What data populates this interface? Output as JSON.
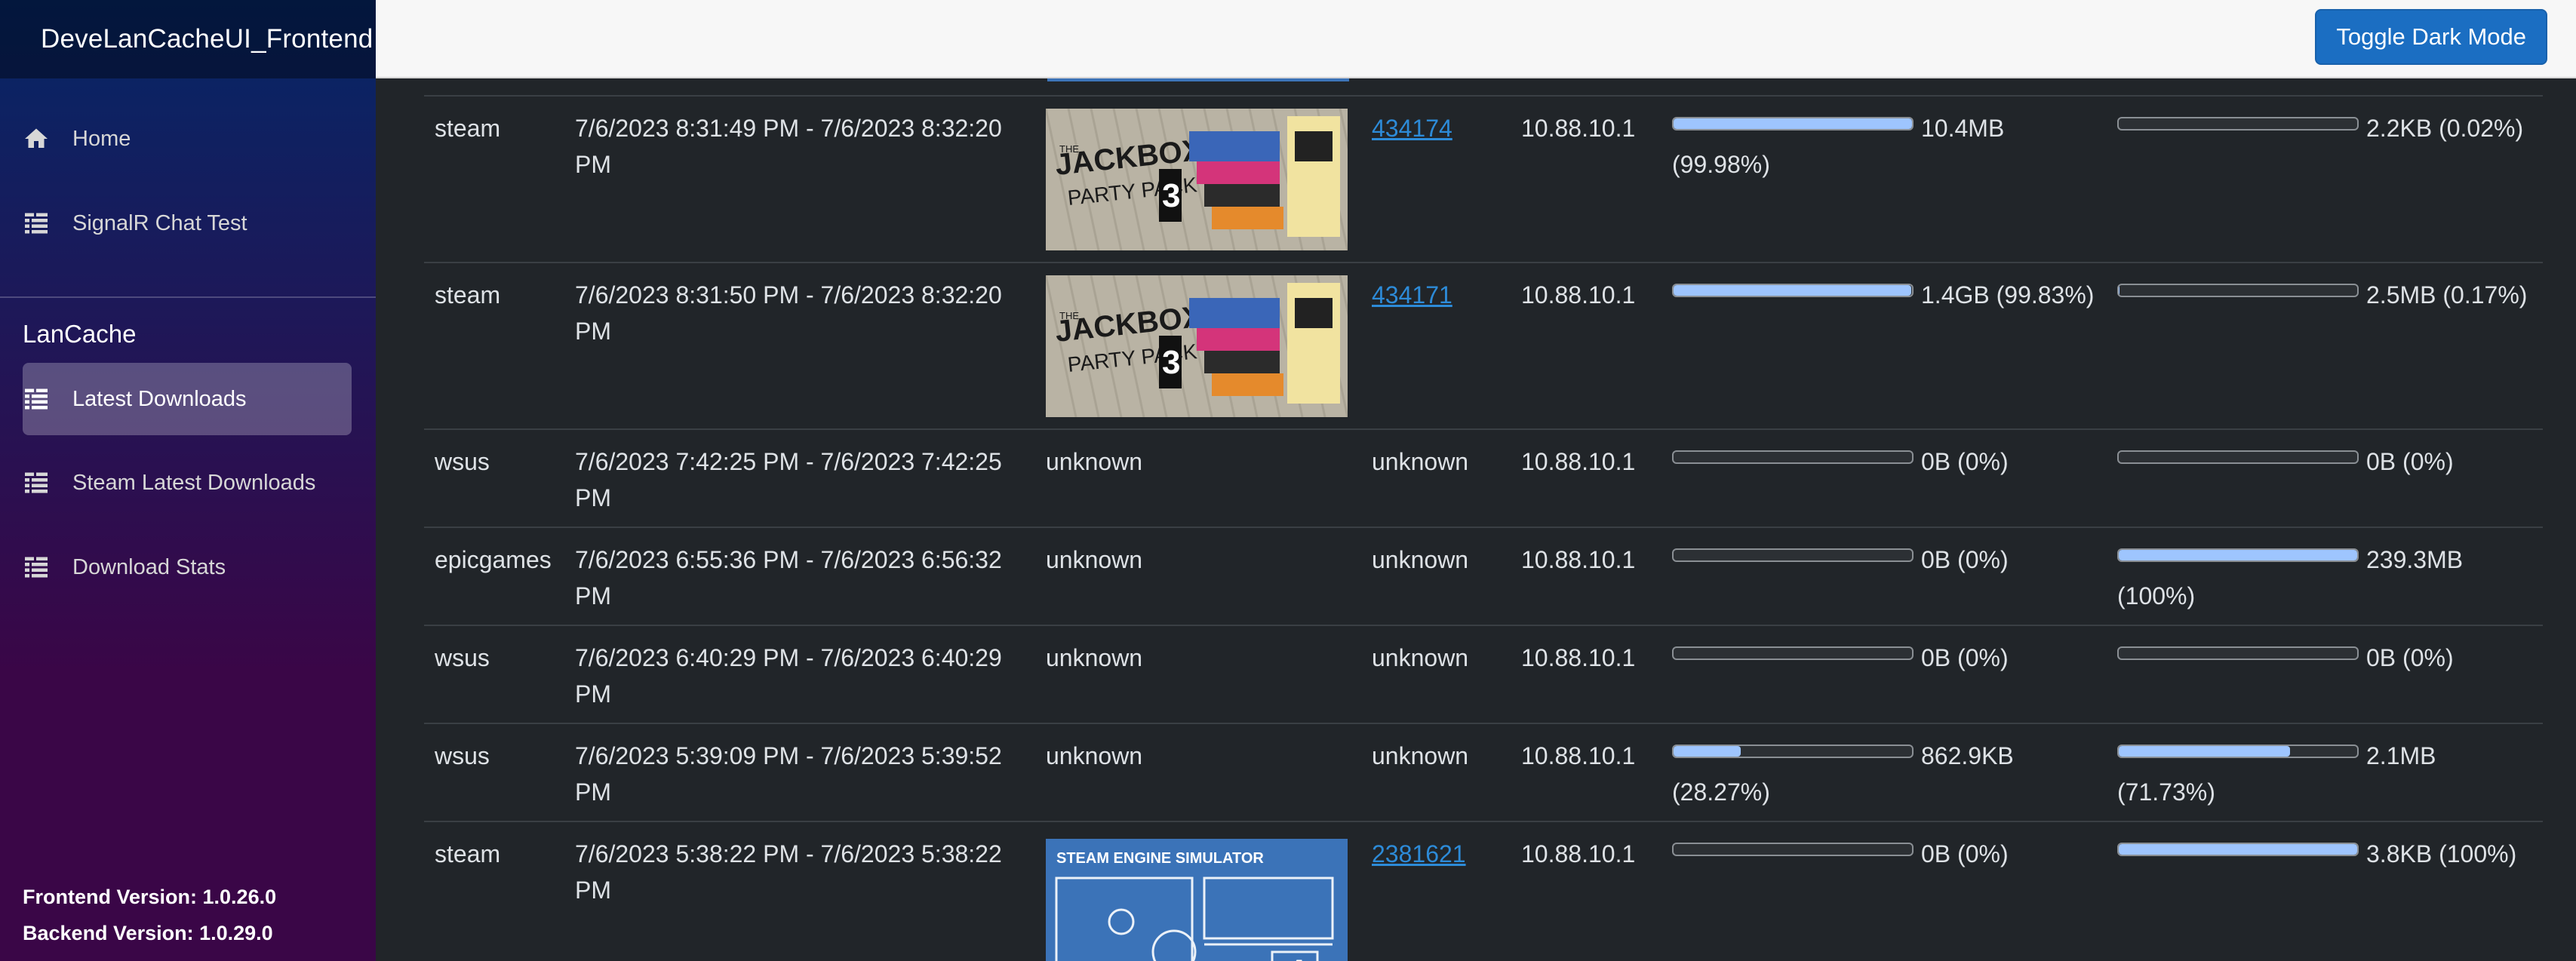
{
  "app": {
    "title": "DeveLanCacheUI_Frontend"
  },
  "sidebar": {
    "items": [
      {
        "label": "Home",
        "icon": "home-icon"
      },
      {
        "label": "SignalR Chat Test",
        "icon": "list-icon"
      }
    ],
    "section_heading": "LanCache",
    "lancache_items": [
      {
        "label": "Latest Downloads",
        "icon": "list-icon",
        "active": true
      },
      {
        "label": "Steam Latest Downloads",
        "icon": "list-icon"
      },
      {
        "label": "Download Stats",
        "icon": "list-icon"
      }
    ],
    "frontend_version": "Frontend Version: 1.0.26.0",
    "backend_version": "Backend Version: 1.0.29.0"
  },
  "topbar": {
    "toggle_label": "Toggle Dark Mode"
  },
  "downloads": [
    {
      "service": "steam",
      "time": "7/6/2023 8:31:49 PM - 7/6/2023 8:32:20 PM",
      "thumb": "jackbox-party-pack-3",
      "game": "434174",
      "ip": "10.88.10.1",
      "hit_text": "10.4MB (99.98%)",
      "hit_pct": 99.98,
      "miss_text": "2.2KB (0.02%)",
      "miss_pct": 0.02
    },
    {
      "service": "steam",
      "time": "7/6/2023 8:31:50 PM - 7/6/2023 8:32:20 PM",
      "thumb": "jackbox-party-pack-3",
      "game": "434171",
      "ip": "10.88.10.1",
      "hit_text": "1.4GB (99.83%)",
      "hit_pct": 99.83,
      "miss_text": "2.5MB (0.17%)",
      "miss_pct": 0.17
    },
    {
      "service": "wsus",
      "time": "7/6/2023 7:42:25 PM - 7/6/2023 7:42:25 PM",
      "thumb_text": "unknown",
      "game_text": "unknown",
      "ip": "10.88.10.1",
      "hit_text": "0B (0%)",
      "hit_pct": 0,
      "miss_text": "0B (0%)",
      "miss_pct": 0
    },
    {
      "service": "epicgames",
      "time": "7/6/2023 6:55:36 PM - 7/6/2023 6:56:32 PM",
      "thumb_text": "unknown",
      "game_text": "unknown",
      "ip": "10.88.10.1",
      "hit_text": "0B (0%)",
      "hit_pct": 0,
      "miss_text": "239.3MB (100%)",
      "miss_pct": 100
    },
    {
      "service": "wsus",
      "time": "7/6/2023 6:40:29 PM - 7/6/2023 6:40:29 PM",
      "thumb_text": "unknown",
      "game_text": "unknown",
      "ip": "10.88.10.1",
      "hit_text": "0B (0%)",
      "hit_pct": 0,
      "miss_text": "0B (0%)",
      "miss_pct": 0
    },
    {
      "service": "wsus",
      "time": "7/6/2023 5:39:09 PM - 7/6/2023 5:39:52 PM",
      "thumb_text": "unknown",
      "game_text": "unknown",
      "ip": "10.88.10.1",
      "hit_text": "862.9KB (28.27%)",
      "hit_pct": 28.27,
      "miss_text": "2.1MB (71.73%)",
      "miss_pct": 71.73
    },
    {
      "service": "steam",
      "time": "7/6/2023 5:38:22 PM - 7/6/2023 5:38:22 PM",
      "thumb": "steam-engine-simulator",
      "game": "2381621",
      "ip": "10.88.10.1",
      "hit_text": "0B (0%)",
      "hit_pct": 0,
      "miss_text": "3.8KB (100%)",
      "miss_pct": 100
    }
  ],
  "thumb_art": {
    "jackbox": {
      "line1": "JACKBOX",
      "line2": "PARTY PACK",
      "number": "3",
      "prefix": "THE"
    },
    "steam_engine": {
      "title": "STEAM ENGINE SIMULATOR",
      "letter": "A"
    }
  },
  "colors": {
    "accent": "#1b6ec2",
    "progress_fill": "#9ec5fe",
    "link": "#2d8bd8"
  }
}
